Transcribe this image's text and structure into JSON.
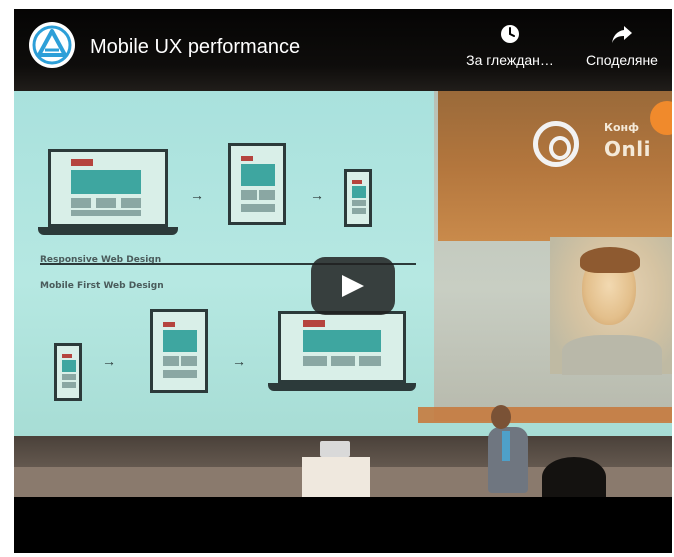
{
  "player": {
    "video_title": "Mobile UX performance",
    "actions": {
      "watch_later_label": "За глеждан…",
      "share_label": "Споделяне"
    },
    "icons": {
      "channel": "channel-logo-icon",
      "watch_later": "clock-icon",
      "share": "share-arrow-icon",
      "play": "play-icon"
    }
  },
  "slide": {
    "label_responsive": "Responsive Web Design",
    "label_mobile_first": "Mobile First Web Design",
    "logo_text_top": "Конф",
    "logo_text_bottom": "Onli"
  },
  "colors": {
    "accent_blue": "#2d9fd8",
    "play_bg": "#212121",
    "slide_teal": "#3ea6a0"
  }
}
